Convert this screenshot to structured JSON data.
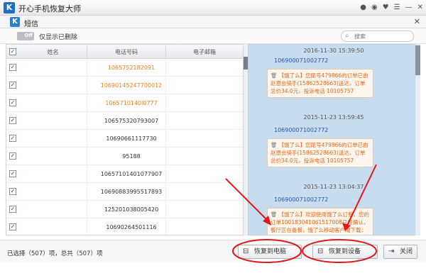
{
  "app": {
    "title": "开心手机恢复大师",
    "logo_letter": "K"
  },
  "window": {
    "title": "短信",
    "logo_letter": "K"
  },
  "toolbar": {
    "toggle_text": "Off",
    "toggle_label": "仅显示已删除",
    "search_placeholder": "搜索"
  },
  "table": {
    "headers": [
      "姓名",
      "电话号码",
      "电子邮箱"
    ],
    "rows": [
      {
        "phone": "1065752182091",
        "deleted": true
      },
      {
        "phone": "10690145247700012",
        "deleted": true
      },
      {
        "phone": "1065710140l0777",
        "deleted": true
      },
      {
        "phone": "106575320793007",
        "deleted": false
      },
      {
        "phone": "10690661117730",
        "deleted": false
      },
      {
        "phone": "95188",
        "deleted": false
      },
      {
        "phone": "10657101401077907",
        "deleted": false
      },
      {
        "phone": "10690883995517893",
        "deleted": false
      },
      {
        "phone": "125201038005420",
        "deleted": false
      },
      {
        "phone": "10690264501116",
        "deleted": false
      }
    ]
  },
  "messages": [
    {
      "time": "2016-11-30 15:39:50",
      "sender": "106900071002772",
      "text": "【饿了么】您尾号479866的订单已由赵恩会骑手(15862528663)送达，订单总价34.0元，投诉电话 10105757"
    },
    {
      "time": "2015-11-23 13:59:45",
      "sender": "106900071002772",
      "text": "【饿了么】您尾号479866的订单已由赵恩会骑手(15862528663)送达，订单总价34.0元，投诉电话 10105757"
    },
    {
      "time": "2015-11-23 13:04:37",
      "sender": "106900071002772",
      "text": "【饿了么】欢迎使用饿了么订餐，您的订单100183041061517008已经确认，餐厅正在备餐，饿了么移动客户端下载：http://m.ele.me/app"
    }
  ],
  "footer": {
    "count_text": "已选择（507）项，总共（507）项",
    "restore_pc": "恢复到电脑",
    "restore_device": "恢复到设备",
    "close": "关闭"
  },
  "colors": {
    "deleted_text": "#e8821e",
    "sender_text": "#2a54b3",
    "chat_bg": "#c8dcef",
    "annotation_red": "#e01818"
  }
}
